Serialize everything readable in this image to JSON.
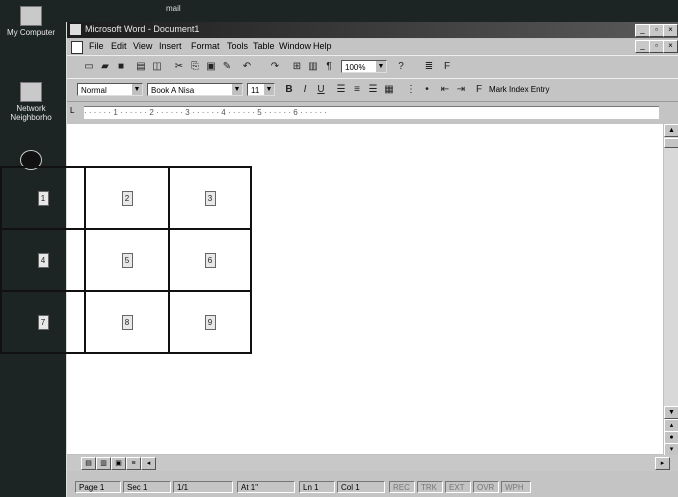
{
  "desktop": {
    "icons": [
      {
        "name": "my-computer-icon",
        "label": "My Computer"
      },
      {
        "name": "network-neighborhood-icon",
        "label": "Network Neighborho"
      },
      {
        "name": "recycle-bin-icon",
        "label": ""
      }
    ],
    "top_label": "mail"
  },
  "window": {
    "title": "Microsoft Word - Document1",
    "menus": [
      "File",
      "Edit",
      "View",
      "Insert",
      "Format",
      "Tools",
      "Table",
      "Window",
      "Help"
    ],
    "zoom": "100%",
    "style": "Normal",
    "font": "Book A Nisa",
    "font_size": "11",
    "mark_index": "Mark Index Entry"
  },
  "table": {
    "rows": [
      [
        "1",
        "2",
        "3"
      ],
      [
        "4",
        "5",
        "6"
      ],
      [
        "7",
        "8",
        "9"
      ]
    ]
  },
  "status": {
    "page": "Page 1",
    "sec": "Sec 1",
    "pages": "1/1",
    "at": "At 1\"",
    "ln": "Ln 1",
    "col": "Col 1",
    "rec": "REC",
    "trk": "TRK",
    "ext": "EXT",
    "ovr": "OVR",
    "wph": "WPH"
  }
}
